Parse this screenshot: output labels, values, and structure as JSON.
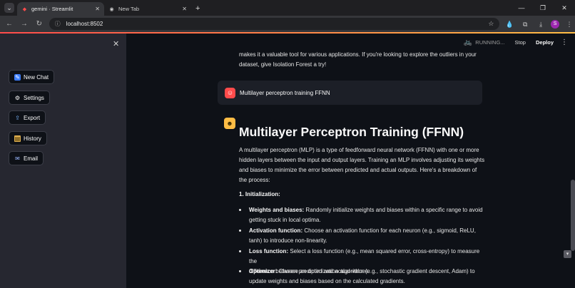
{
  "browser": {
    "tabs": [
      {
        "title": "gemini · Streamlit",
        "active": true
      },
      {
        "title": "New Tab",
        "active": false
      }
    ],
    "url": "localhost:8502",
    "profile_initial": "S"
  },
  "sidebar": {
    "buttons": [
      {
        "label": "New Chat",
        "icon": "chat-icon"
      },
      {
        "label": "Settings",
        "icon": "gear-icon"
      },
      {
        "label": "Export",
        "icon": "export-icon"
      },
      {
        "label": "History",
        "icon": "history-icon"
      },
      {
        "label": "Email",
        "icon": "email-icon"
      }
    ]
  },
  "topbar": {
    "running": "RUNNING...",
    "stop": "Stop",
    "deploy": "Deploy"
  },
  "chat": {
    "prev_text_line1": "makes it a valuable tool for various applications. If you're looking to explore the outliers in your",
    "prev_text_line2": "dataset, give Isolation Forest a try!",
    "user_message": "Multilayer perceptron training FFNN",
    "heading": "Multilayer Perceptron Training (FFNN)",
    "intro_line1": "A multilayer perceptron (MLP) is a type of feedforward neural network (FFNN) with one or more",
    "intro_line2": "hidden layers between the input and output layers. Training an MLP involves adjusting its weights",
    "intro_line3": "and biases to minimize the error between predicted and actual outputs. Here's a breakdown of",
    "intro_line4": "the process:",
    "section1": "1. Initialization:",
    "bullets": [
      {
        "term": "Weights and biases:",
        "line1": " Randomly initialize weights and biases within a specific range to avoid",
        "line2": "getting stuck in local optima."
      },
      {
        "term": "Activation function:",
        "line1": " Choose an activation function for each neuron (e.g., sigmoid, ReLU,",
        "line2": "tanh) to introduce non-linearity."
      },
      {
        "term": "Loss function:",
        "line1": " Select a loss function (e.g., mean squared error, cross-entropy) to measure the",
        "line2": "difference between predicted and actual values."
      },
      {
        "term": "Optimizer:",
        "line1": " Choose an optimization algorithm (e.g., stochastic gradient descent, Adam) to",
        "line2": "update weights and biases based on the calculated gradients."
      }
    ]
  },
  "colors": {
    "accent_red": "#ff4b4b",
    "accent_yellow": "#ffbd45",
    "sidebar_bg": "#262730",
    "main_bg": "#0e1117"
  }
}
